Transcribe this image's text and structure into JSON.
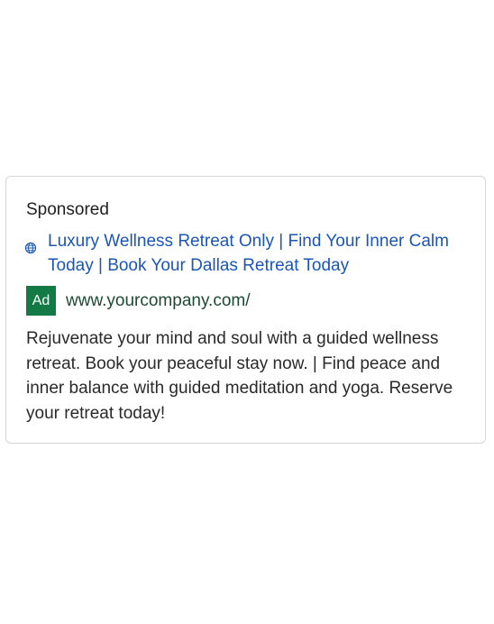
{
  "ad": {
    "sponsored_label": "Sponsored",
    "headline": "Luxury Wellness Retreat Only | Find Your Inner Calm Today | Book Your Dallas Retreat Today",
    "badge": "Ad",
    "display_url": "www.yourcompany.com/",
    "description": "Rejuvenate your mind and soul with a guided wellness retreat. Book your peaceful stay now. | Find peace and inner balance with guided meditation and yoga. Reserve your retreat today!",
    "icons": {
      "headline": "globe-icon"
    },
    "colors": {
      "headline": "#1a55b8",
      "badge_bg": "#137a45",
      "url": "#1e4a35",
      "border": "#d6d6d6"
    }
  }
}
